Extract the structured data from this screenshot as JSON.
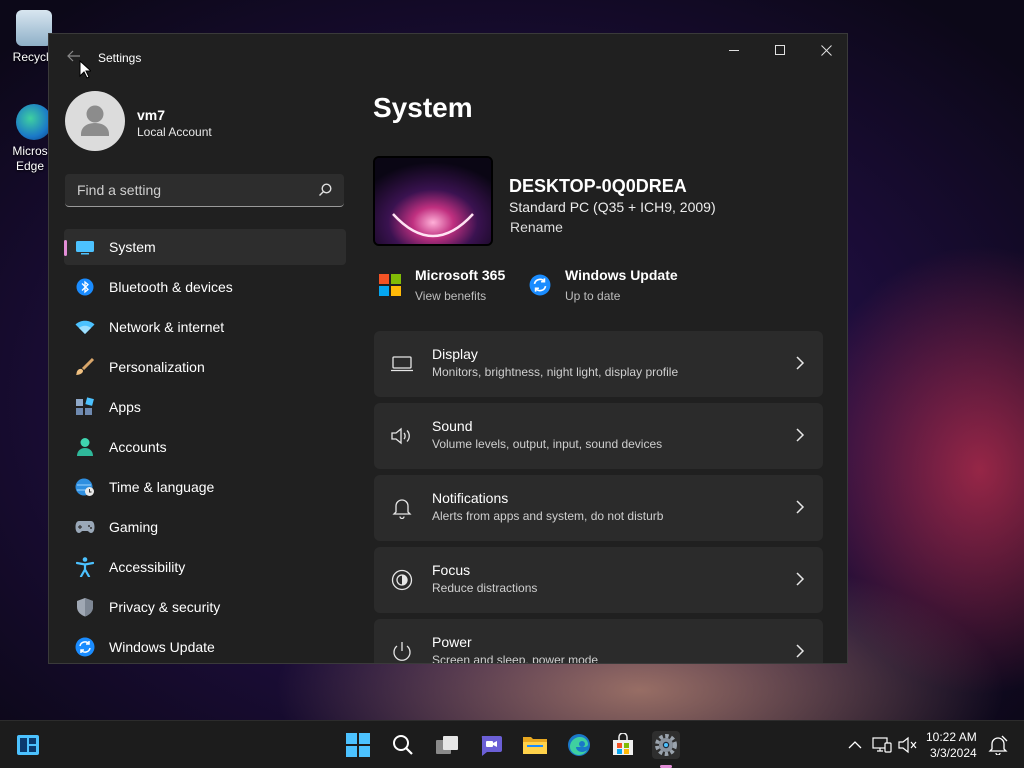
{
  "desktop": {
    "icons": [
      {
        "label": "Recycle"
      },
      {
        "label": "Micros Edge"
      }
    ]
  },
  "window": {
    "title": "Settings",
    "controls": {
      "minimize": "minimize",
      "maximize": "maximize",
      "close": "close"
    }
  },
  "profile": {
    "name": "vm7",
    "account_type": "Local Account"
  },
  "search": {
    "placeholder": "Find a setting"
  },
  "nav": {
    "items": [
      {
        "label": "System",
        "icon": "system-icon",
        "active": true
      },
      {
        "label": "Bluetooth & devices",
        "icon": "bluetooth-icon"
      },
      {
        "label": "Network & internet",
        "icon": "wifi-icon"
      },
      {
        "label": "Personalization",
        "icon": "brush-icon"
      },
      {
        "label": "Apps",
        "icon": "apps-icon"
      },
      {
        "label": "Accounts",
        "icon": "person-icon"
      },
      {
        "label": "Time & language",
        "icon": "globe-clock-icon"
      },
      {
        "label": "Gaming",
        "icon": "controller-icon"
      },
      {
        "label": "Accessibility",
        "icon": "accessibility-icon"
      },
      {
        "label": "Privacy & security",
        "icon": "shield-icon"
      },
      {
        "label": "Windows Update",
        "icon": "update-icon"
      }
    ]
  },
  "main": {
    "title": "System",
    "device": {
      "name": "DESKTOP-0Q0DREA",
      "spec": "Standard PC (Q35 + ICH9, 2009)",
      "rename": "Rename"
    },
    "quick": [
      {
        "title": "Microsoft 365",
        "sub": "View benefits",
        "icon": "microsoft-logo-icon"
      },
      {
        "title": "Windows Update",
        "sub": "Up to date",
        "icon": "update-icon"
      }
    ],
    "cards": [
      {
        "title": "Display",
        "sub": "Monitors, brightness, night light, display profile",
        "icon": "display-icon"
      },
      {
        "title": "Sound",
        "sub": "Volume levels, output, input, sound devices",
        "icon": "speaker-icon"
      },
      {
        "title": "Notifications",
        "sub": "Alerts from apps and system, do not disturb",
        "icon": "bell-icon"
      },
      {
        "title": "Focus",
        "sub": "Reduce distractions",
        "icon": "focus-icon"
      },
      {
        "title": "Power",
        "sub": "Screen and sleep, power mode",
        "icon": "power-icon"
      }
    ]
  },
  "taskbar": {
    "time": "10:22 AM",
    "date": "3/3/2024",
    "accent": "#e28dd6"
  }
}
